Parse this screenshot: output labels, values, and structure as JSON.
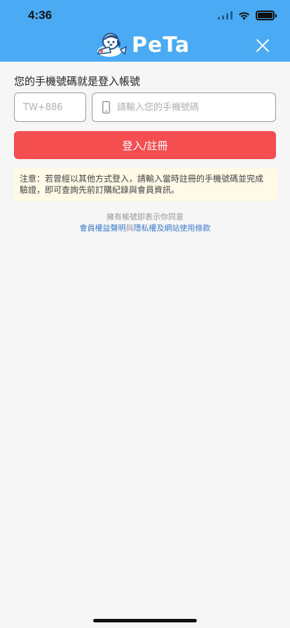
{
  "status_bar": {
    "time": "4:36"
  },
  "header": {
    "logo_text": "PeTa",
    "close_icon": "close-icon",
    "background_color": "#4aaaf4"
  },
  "login": {
    "title": "您的手機號碼就是登入帳號",
    "country_code_placeholder": "TW+886",
    "phone_placeholder": "請輸入您的手機號碼",
    "phone_icon": "mobile-phone-icon",
    "submit_label": "登入/註冊",
    "submit_color": "#f44e50"
  },
  "notice": {
    "text": "注意：若曾經以其他方式登入，請輸入當時註冊的手機號碼並完成驗證，即可查詢先前訂購紀錄與會員資訊。"
  },
  "terms": {
    "prefix": "擁有帳號即表示你同意",
    "link1": "會員權益聲明",
    "conjunction": "與",
    "link2": "隱私權及網站使用條款",
    "link_color": "#3d7bd0"
  }
}
